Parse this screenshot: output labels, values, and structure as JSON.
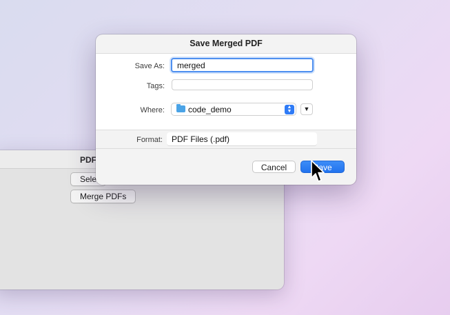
{
  "background_window": {
    "title": "PDF",
    "select_button": "Sele",
    "merge_button": "Merge PDFs"
  },
  "dialog": {
    "title": "Save Merged PDF",
    "save_as_label": "Save As:",
    "save_as_value": "merged",
    "tags_label": "Tags:",
    "tags_value": "",
    "where_label": "Where:",
    "where_value": "code_demo",
    "format_label": "Format:",
    "format_value": "PDF Files (.pdf)",
    "cancel_label": "Cancel",
    "save_label": "Save"
  },
  "colors": {
    "accent": "#2f7bf6",
    "focus_ring": "#4d8ff0",
    "folder": "#4aa3e6"
  },
  "icons": {
    "folder": "folder-icon",
    "popup_arrows": "up-down-chevron-icon",
    "expand": "chevron-down-icon",
    "cursor": "mouse-pointer-icon"
  }
}
